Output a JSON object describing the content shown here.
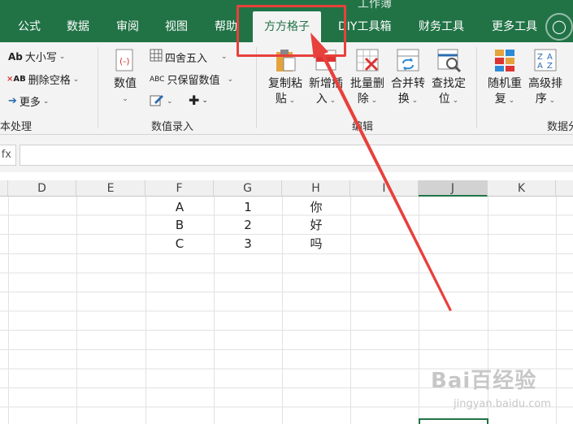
{
  "window": {
    "title": "工作簿"
  },
  "tabs": [
    "公式",
    "数据",
    "审阅",
    "视图",
    "帮助",
    "方方格子",
    "DIY工具箱",
    "财务工具",
    "更多工具"
  ],
  "active_tab": "方方格子",
  "ribbon": {
    "text_group": {
      "case_label": "大小写",
      "case_glyph": "Ab",
      "trim_label": "删除空格",
      "trim_glyph": "AB",
      "more_label": "更多",
      "group_label": "本处理"
    },
    "number_group": {
      "numeric_label": "数值",
      "round_label": "四舍五入",
      "keep_label": "只保留数值",
      "keep_glyph": "ABC",
      "group_label": "数值录入"
    },
    "edit_group": {
      "copy_paste_label": [
        "复制粘",
        "贴"
      ],
      "insert_label": [
        "新增插",
        "入"
      ],
      "bulk_delete_label": [
        "批量删",
        "除"
      ],
      "merge_convert_label": [
        "合并转",
        "换"
      ],
      "find_locate_label": [
        "查找定",
        "位"
      ],
      "group_label": "编辑"
    },
    "data_group": {
      "random_repeat_label": [
        "随机重",
        "复"
      ],
      "advanced_sort_label": [
        "高级排",
        "序"
      ],
      "group_label": "数据分"
    }
  },
  "formula_bar": {
    "namebox_fragment": "fx"
  },
  "sheet": {
    "columns": [
      "D",
      "E",
      "F",
      "G",
      "H",
      "I",
      "J",
      "K"
    ],
    "selected_column": "J",
    "rows": [
      {
        "F": "A",
        "G": "1",
        "H": "你"
      },
      {
        "F": "B",
        "G": "2",
        "H": "好"
      },
      {
        "F": "C",
        "G": "3",
        "H": "吗"
      }
    ]
  },
  "watermark": {
    "main": "Bai百经验",
    "sub": "jingyan.baidu.com"
  },
  "colors": {
    "excel_green": "#217346",
    "annotation_red": "#e8403c"
  }
}
